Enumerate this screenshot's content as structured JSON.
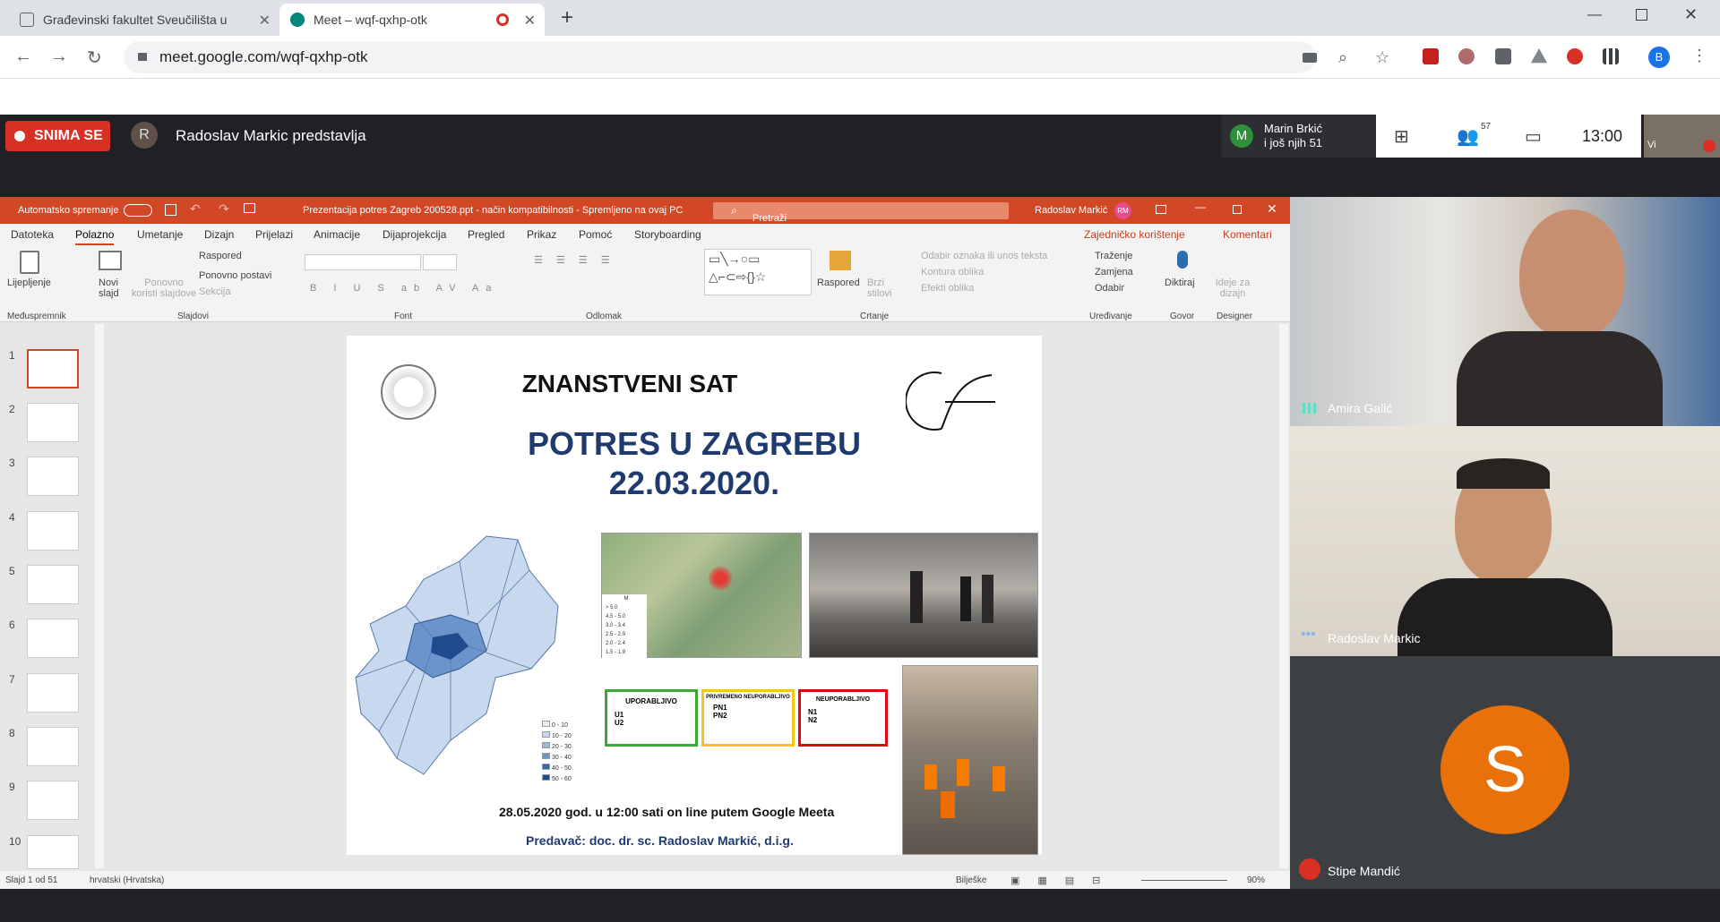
{
  "browser": {
    "tabs": [
      {
        "label": "Građevinski fakultet Sveučilišta u"
      },
      {
        "label": "Meet – wqf-qxhp-otk"
      }
    ],
    "url": "meet.google.com/wqf-qxhp-otk",
    "profile": "B"
  },
  "meet": {
    "recording": "SNIMA SE",
    "presenter_initial": "R",
    "presenter": "Radoslav Markic predstavlja",
    "participant_initial": "M",
    "participant_name": "Marin Brkić",
    "participant_more": "i još njih 51",
    "people_count": "57",
    "time": "13:00",
    "self_label": "Vi"
  },
  "ppt": {
    "autosave": "Automatsko spremanje",
    "doc_title": "Prezentacija potres Zagreb 200528.ppt  -  način kompatibilnosti  -  Spremljeno na ovaj PC",
    "search": "Pretraži",
    "user": "Radoslav Markić",
    "user_initials": "RM",
    "menu": [
      "Datoteka",
      "Polazno",
      "Umetanje",
      "Dizajn",
      "Prijelazi",
      "Animacije",
      "Dijaprojekcija",
      "Pregled",
      "Prikaz",
      "Pomoć",
      "Storyboarding"
    ],
    "share": "Zajedničko korištenje",
    "comments": "Komentari",
    "ribbon": {
      "paste": "Lijepljenje",
      "new_slide": "Novi slajd",
      "reuse": "Ponovno koristi slajdove",
      "layout": "Raspored",
      "reset": "Ponovno postavi",
      "section": "Sekcija",
      "arrange": "Raspored",
      "quick_styles": "Brzi stilovi",
      "fill": "Odabir oznaka ili unos teksta",
      "outline": "Kontura oblika",
      "effects": "Efekti oblika",
      "find": "Traženje",
      "replace": "Zamjena",
      "select": "Odabir",
      "dictate": "Diktiraj",
      "designer": "Ideje za dizajn"
    },
    "groups": [
      "Međuspremnik",
      "Slajdovi",
      "Font",
      "Odlomak",
      "Crtanje",
      "Uređivanje",
      "Govor",
      "Designer"
    ],
    "thumb_numbers": [
      "1",
      "2",
      "3",
      "4",
      "5",
      "6",
      "7",
      "8",
      "9",
      "10"
    ],
    "status_slide": "Slajd 1 od 51",
    "status_lang": "hrvatski (Hrvatska)",
    "notes": "Bilješke",
    "zoom": "90%"
  },
  "slide": {
    "heading": "ZNANSTVENI SAT",
    "title1": "POTRES U ZAGREBU",
    "title2": "22.03.2020.",
    "legend_title": "M",
    "mag_legend": [
      "> 5.0",
      "4.5 - 5.0",
      "3.0 - 3.4",
      "2.5 - 2.9",
      "2.0 - 2.4",
      "1.5 - 1.9"
    ],
    "map_legend": [
      "0 - 10",
      "10 - 20",
      "20 - 30",
      "30 - 40",
      "40 - 50",
      "50 - 60"
    ],
    "label_green": "UPORABLJIVO",
    "label_yellow": "PRIVREMENO NEUPORABLJIVO",
    "label_red": "NEUPORABLJIVO",
    "code_u1": "U1",
    "code_u2": "U2",
    "code_pn1": "PN1",
    "code_pn2": "PN2",
    "code_n1": "N1",
    "code_n2": "N2",
    "date_line": "28.05.2020 god.  u 12:00 sati on line putem Google Meeta",
    "lecturer": "Predavač: doc. dr. sc. Radoslav Markić, d.i.g."
  },
  "tiles": [
    {
      "name": "Amira Galić"
    },
    {
      "name": "Radoslav Markic"
    },
    {
      "name": "Stipe Mandić",
      "initial": "S"
    }
  ],
  "colors": {
    "ppt_red": "#d24726",
    "title_blue": "#1f3a6e",
    "record_red": "#d93025",
    "avatar_orange": "#e8710a"
  }
}
